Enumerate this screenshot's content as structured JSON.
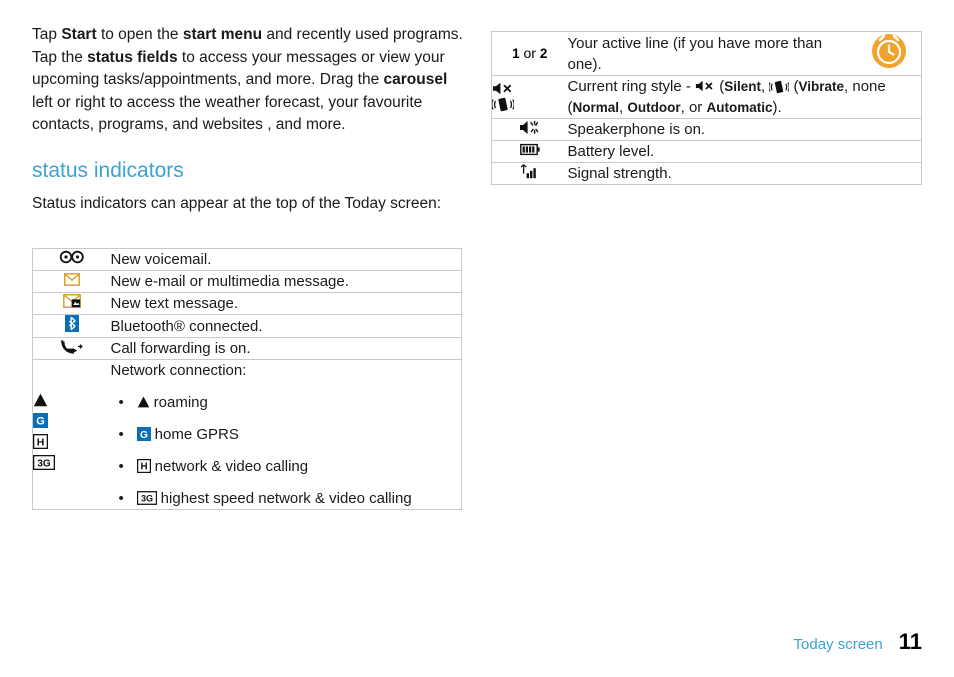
{
  "left": {
    "intro_parts": {
      "p1_a": "Tap ",
      "p1_start": "Start",
      "p1_b": " to open the ",
      "p1_startmenu": "start menu",
      "p1_c": " and recently used programs. Tap the ",
      "p1_statusfields": "status fields",
      "p1_d": " to access your messages or view your upcoming tasks/appointments, and more. Drag the ",
      "p1_carousel": "carousel",
      "p1_e": " left or right to access the weather forecast, your favourite contacts, programs, and websites , and more."
    },
    "section_title": "status indicators",
    "lead": "Status indicators can appear at the top of the Today screen:",
    "rows": [
      {
        "icon": "voicemail-icon",
        "text": "New voicemail."
      },
      {
        "icon": "envelope-icon",
        "text": "New e-mail or multimedia message."
      },
      {
        "icon": "text-message-icon",
        "text": "New text message."
      },
      {
        "icon": "bluetooth-icon",
        "text": "Bluetooth® connected."
      },
      {
        "icon": "call-forward-icon",
        "text": "Call forwarding is on."
      }
    ],
    "network_row": {
      "title": "Network connection:",
      "icons": [
        "roaming-icon",
        "gprs-icon",
        "hsdpa-icon",
        "hspa-3g-icon"
      ],
      "items": [
        {
          "icon": "roaming-icon",
          "label": "roaming"
        },
        {
          "icon": "gprs-icon",
          "label": "home GPRS"
        },
        {
          "icon": "hsdpa-icon",
          "label": "network & video calling"
        },
        {
          "icon": "hspa-3g-icon",
          "label": "highest speed network & video calling"
        }
      ]
    }
  },
  "right": {
    "rows": [
      {
        "icon": "line-1-2-icon",
        "line_a": "1",
        "line_or": " or ",
        "line_b": "2",
        "text": "Your active line (if you have more than one).",
        "trailing_icon": "alarm-icon"
      },
      {
        "icon": "ring-style-icon",
        "text_a": "Current ring style - ",
        "silent_label": "Silent",
        "text_b": ", ",
        "vibrate_label": "Vibrate",
        "text_c": ", none (",
        "normal_label": "Normal",
        "text_d": ", ",
        "outdoor_label": "Outdoor",
        "text_e": ", or ",
        "automatic_label": "Automatic",
        "text_f": ")."
      },
      {
        "icon": "speakerphone-icon",
        "text": "Speakerphone is on."
      },
      {
        "icon": "battery-icon",
        "text": "Battery level."
      },
      {
        "icon": "signal-icon",
        "text": "Signal strength."
      }
    ]
  },
  "footer": {
    "label": "Today screen",
    "page": "11"
  },
  "colors": {
    "accent": "#3ba3d0",
    "rule": "#c9c9c9",
    "text": "#1a1a1a"
  }
}
